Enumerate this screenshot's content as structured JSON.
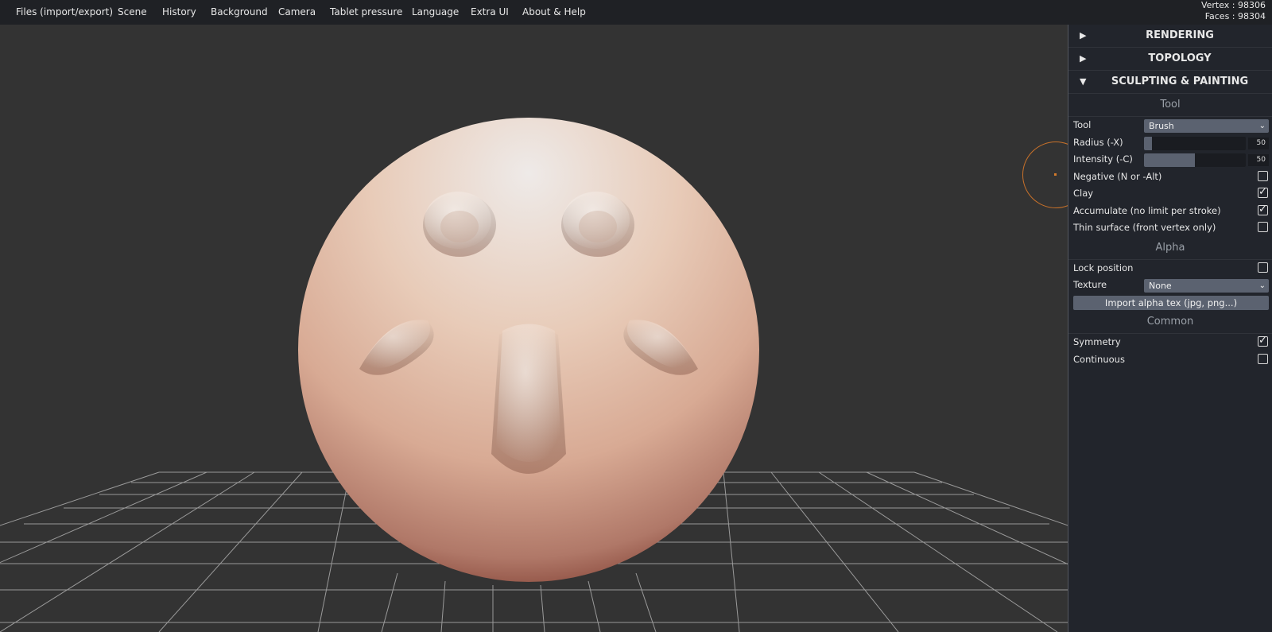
{
  "menu": [
    "Files (import/export)",
    "Scene",
    "History",
    "Background",
    "Camera",
    "Tablet pressure",
    "Language",
    "Extra UI",
    "About & Help"
  ],
  "stats": {
    "vertex": "Vertex : 98306",
    "faces": "Faces : 98304"
  },
  "panel": {
    "folders": {
      "rendering": "RENDERING",
      "topology": "TOPOLOGY",
      "sculpting": "SCULPTING & PAINTING"
    },
    "tool_section": {
      "title": "Tool",
      "tool_label": "Tool",
      "tool_value": "Brush",
      "radius_label": "Radius (-X)",
      "radius_value": "50",
      "radius_fill": 0.08,
      "intensity_label": "Intensity (-C)",
      "intensity_value": "50",
      "intensity_fill": 0.5,
      "negative_label": "Negative (N or -Alt)",
      "negative_checked": false,
      "clay_label": "Clay",
      "clay_checked": true,
      "accumulate_label": "Accumulate (no limit per stroke)",
      "accumulate_checked": true,
      "thin_label": "Thin surface (front vertex only)",
      "thin_checked": false
    },
    "alpha_section": {
      "title": "Alpha",
      "lock_label": "Lock position",
      "lock_checked": false,
      "texture_label": "Texture",
      "texture_value": "None",
      "import_label": "Import alpha tex (jpg, png...)"
    },
    "common_section": {
      "title": "Common",
      "symmetry_label": "Symmetry",
      "symmetry_checked": true,
      "continuous_label": "Continuous",
      "continuous_checked": false
    }
  },
  "icons": {
    "collapsed": "triangle-right-icon",
    "expanded": "triangle-down-icon",
    "check": "checkmark-icon",
    "dropdown": "chevron-down-icon"
  },
  "colors": {
    "background": "#333333",
    "menubar": "#1f2125",
    "panel": "#22252c",
    "control": "#5b6270",
    "brush_cursor": "#c8712a",
    "mesh_light": "#e8e0dc",
    "mesh_dark": "#5a1a14"
  }
}
